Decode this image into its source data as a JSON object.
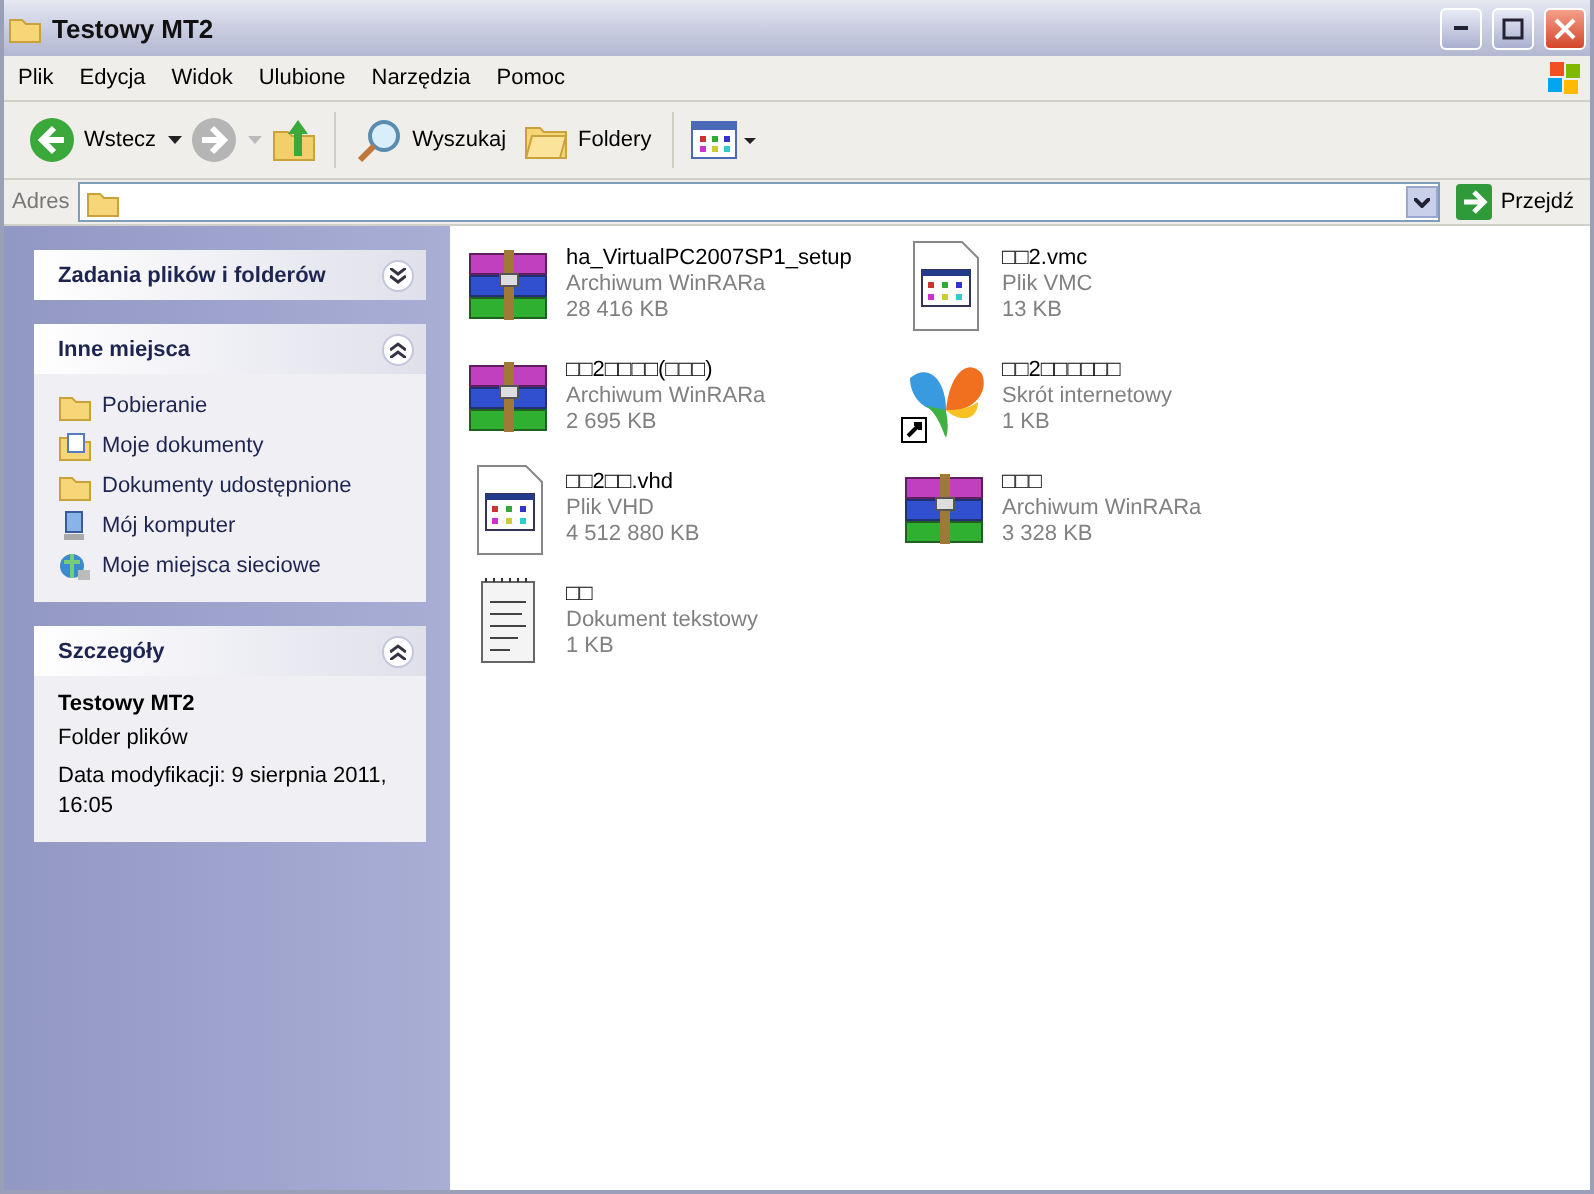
{
  "window": {
    "title": "Testowy MT2"
  },
  "menu": [
    "Plik",
    "Edycja",
    "Widok",
    "Ulubione",
    "Narzędzia",
    "Pomoc"
  ],
  "toolbar": {
    "back": "Wstecz",
    "search": "Wyszukaj",
    "folders": "Foldery"
  },
  "address": {
    "label": "Adres",
    "go": "Przejdź"
  },
  "panels": [
    {
      "title": "Zadania plików i folderów",
      "expanded": false
    },
    {
      "title": "Inne miejsca",
      "expanded": true,
      "links": [
        {
          "label": "Pobieranie",
          "kind": "folder"
        },
        {
          "label": "Moje dokumenty",
          "kind": "documents"
        },
        {
          "label": "Dokumenty udostępnione",
          "kind": "folder"
        },
        {
          "label": "Mój komputer",
          "kind": "computer"
        },
        {
          "label": "Moje miejsca sieciowe",
          "kind": "network"
        }
      ]
    },
    {
      "title": "Szczegóły",
      "expanded": true,
      "details": {
        "name": "Testowy MT2",
        "type": "Folder plików",
        "modified": "Data modyfikacji: 9 sierpnia 2011, 16:05"
      }
    }
  ],
  "files": [
    {
      "name": "ha_VirtualPC2007SP1_setup",
      "type": "Archiwum WinRARa",
      "size": "28 416 KB",
      "kind": "archive"
    },
    {
      "name": "□□2.vmc",
      "type": "Plik VMC",
      "size": "13 KB",
      "kind": "app-file"
    },
    {
      "name": "□□2□□□□(□□□)",
      "type": "Archiwum WinRARa",
      "size": "2 695 KB",
      "kind": "archive"
    },
    {
      "name": "□□2□□□□□□",
      "type": "Skrót internetowy",
      "size": "1 KB",
      "kind": "shortcut"
    },
    {
      "name": "□□2□□.vhd",
      "type": "Plik VHD",
      "size": "4 512 880 KB",
      "kind": "app-file"
    },
    {
      "name": "□□□",
      "type": "Archiwum WinRARa",
      "size": "3 328 KB",
      "kind": "archive"
    },
    {
      "name": "□□",
      "type": "Dokument tekstowy",
      "size": "1 KB",
      "kind": "text"
    }
  ]
}
